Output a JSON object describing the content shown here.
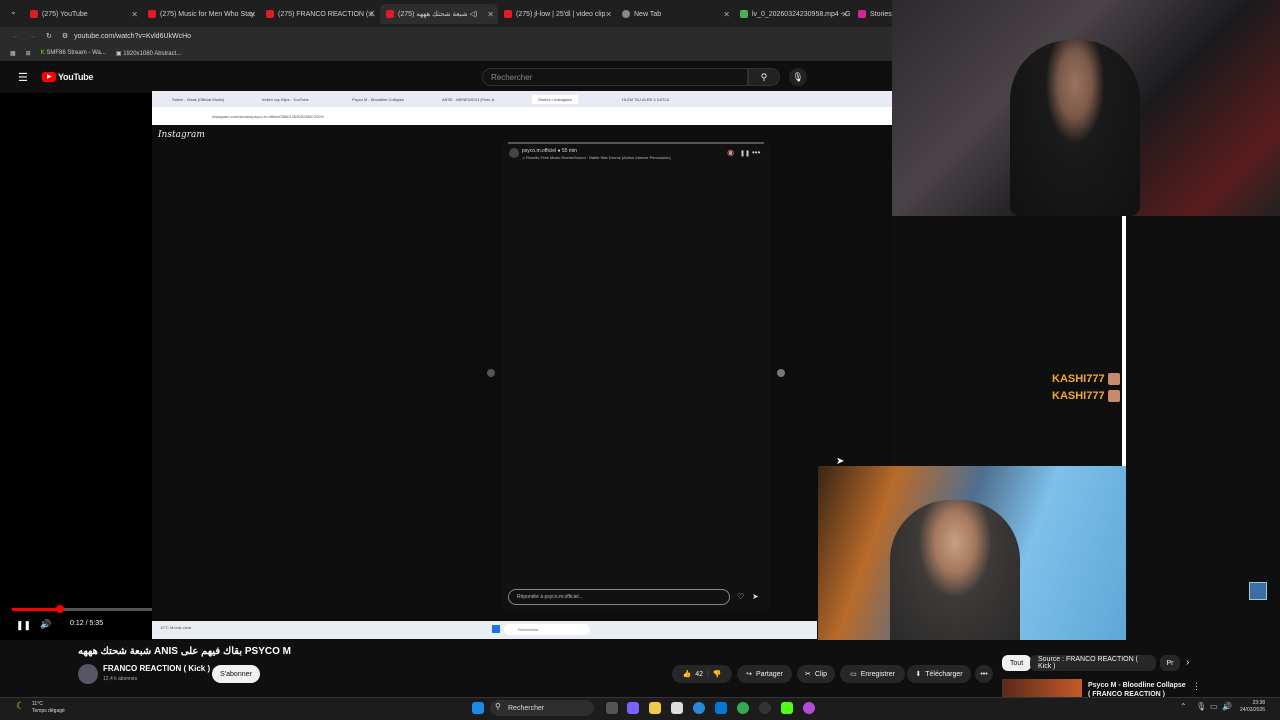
{
  "browser": {
    "tabs": [
      {
        "label": "(275) YouTube"
      },
      {
        "label": "(275) Music for Men Who Stay"
      },
      {
        "label": "(275) FRANCO REACTION ( K"
      },
      {
        "label": "شبعة شحتك هههه (275) ◁)"
      },
      {
        "label": "(275) jl-low | 25'dl | video clip"
      },
      {
        "label": "New Tab"
      },
      {
        "label": "lv_0_20260324230958.mp4 - G"
      },
      {
        "label": "Stories"
      }
    ],
    "url": "youtube.com/watch?v=Kvld6UkWcHo",
    "bookmarks": [
      "SMF86 Stream - Wa...",
      "1920x1080 Abstract..."
    ]
  },
  "youtube": {
    "logo": "YouTube",
    "search_placeholder": "Rechercher"
  },
  "player": {
    "inner": {
      "tabs": [
        "Salem - Sisak (Official Music)",
        "Indien rap Klips - YouTube",
        "Psyco M - Bloodline Collapse",
        "AKSE - MENENSCH (Feat. A",
        "Stories • Instagram",
        "HLEM TAJ ALEB X KATLA"
      ],
      "url": "instagram.com/stories/psyco.m.officiel/3860126905238872003/",
      "brand": "Instagram",
      "story_user": "psyco.m.officiel ● 55 min",
      "story_music": "♫ Rosello Free Music EnerexSound · Battle War Drums (Action Intense Percussion)",
      "reply_placeholder": "Répondre à psyco.m.officiel...",
      "taskbar_search": "Rechercher",
      "weather": "12°C Mostly clear"
    },
    "time": "0:12 / 5:35",
    "progress": 0.036
  },
  "chat": {
    "names": [
      "KASHI777",
      "KASHI777"
    ]
  },
  "video": {
    "title": "شبعة شحتك هههه ANIS بقاك فيهم على PSYCO M",
    "channel": "FRANCO REACTION ( Kick )",
    "subscribers": "12,4 k abonnés",
    "subscribe": "S'abonner",
    "likes": "42",
    "share": "Partager",
    "clip": "Clip",
    "save": "Enregistrer",
    "download": "Télécharger"
  },
  "recommendations": {
    "chips": [
      "Tout",
      "Source : FRANCO REACTION ( Kick )",
      "Pr"
    ],
    "first_title": "Psyco M - Bloodline Collapse ( FRANCO REACTION )"
  },
  "taskbar": {
    "weather_temp": "11°C",
    "weather_desc": "Temps dégagé",
    "search": "Rechercher",
    "time": "23:38",
    "date": "24/03/2026"
  },
  "colors": {
    "yt_red": "#ff0000",
    "chat_name": "#f0a830",
    "bg": "#0f0f0f"
  }
}
